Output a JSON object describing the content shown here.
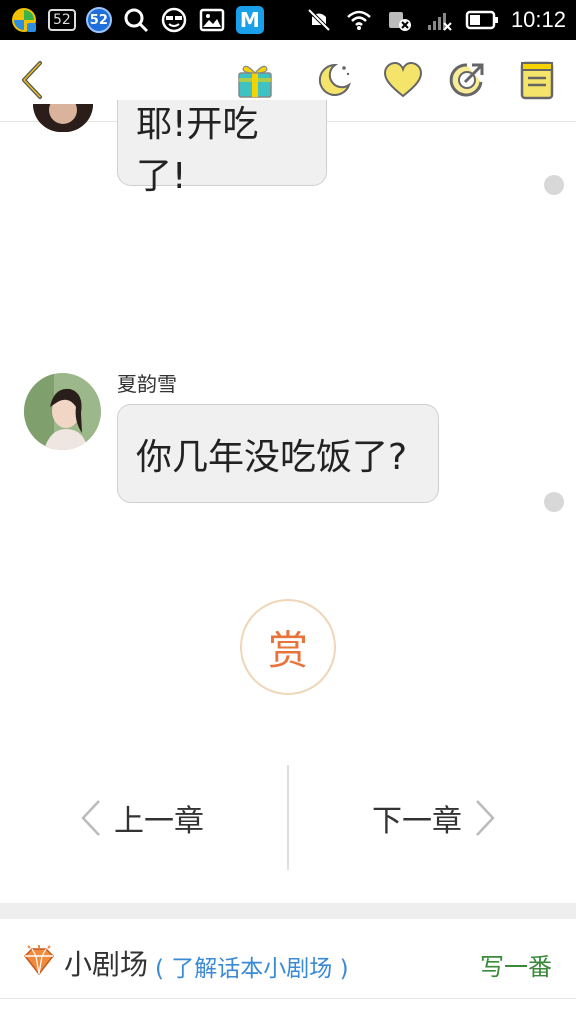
{
  "status_bar": {
    "time": "10:12",
    "badge_52": "52",
    "circle_52": "52",
    "app_m": "M"
  },
  "toolbar": {
    "back_icon": "chevron-left-icon",
    "gift_icon": "gift-icon",
    "night_icon": "moon-icon",
    "like_icon": "heart-icon",
    "share_icon": "share-icon",
    "catalog_icon": "book-icon"
  },
  "chat": {
    "message1_text": "耶!开吃了!",
    "message2_sender": "夏韵雪",
    "message2_text": "你几年没吃饭了?"
  },
  "reward": {
    "label": "赏"
  },
  "chapter_nav": {
    "prev_label": "上一章",
    "next_label": "下一章"
  },
  "theater": {
    "title": "小剧场",
    "learn_more": "( 了解话本小剧场 )",
    "write_label": "写一番"
  },
  "colors": {
    "accent_orange": "#e8743b",
    "icon_yellow": "#f5d300",
    "link_blue": "#3a8ad6",
    "write_green": "#3a8a3a"
  }
}
